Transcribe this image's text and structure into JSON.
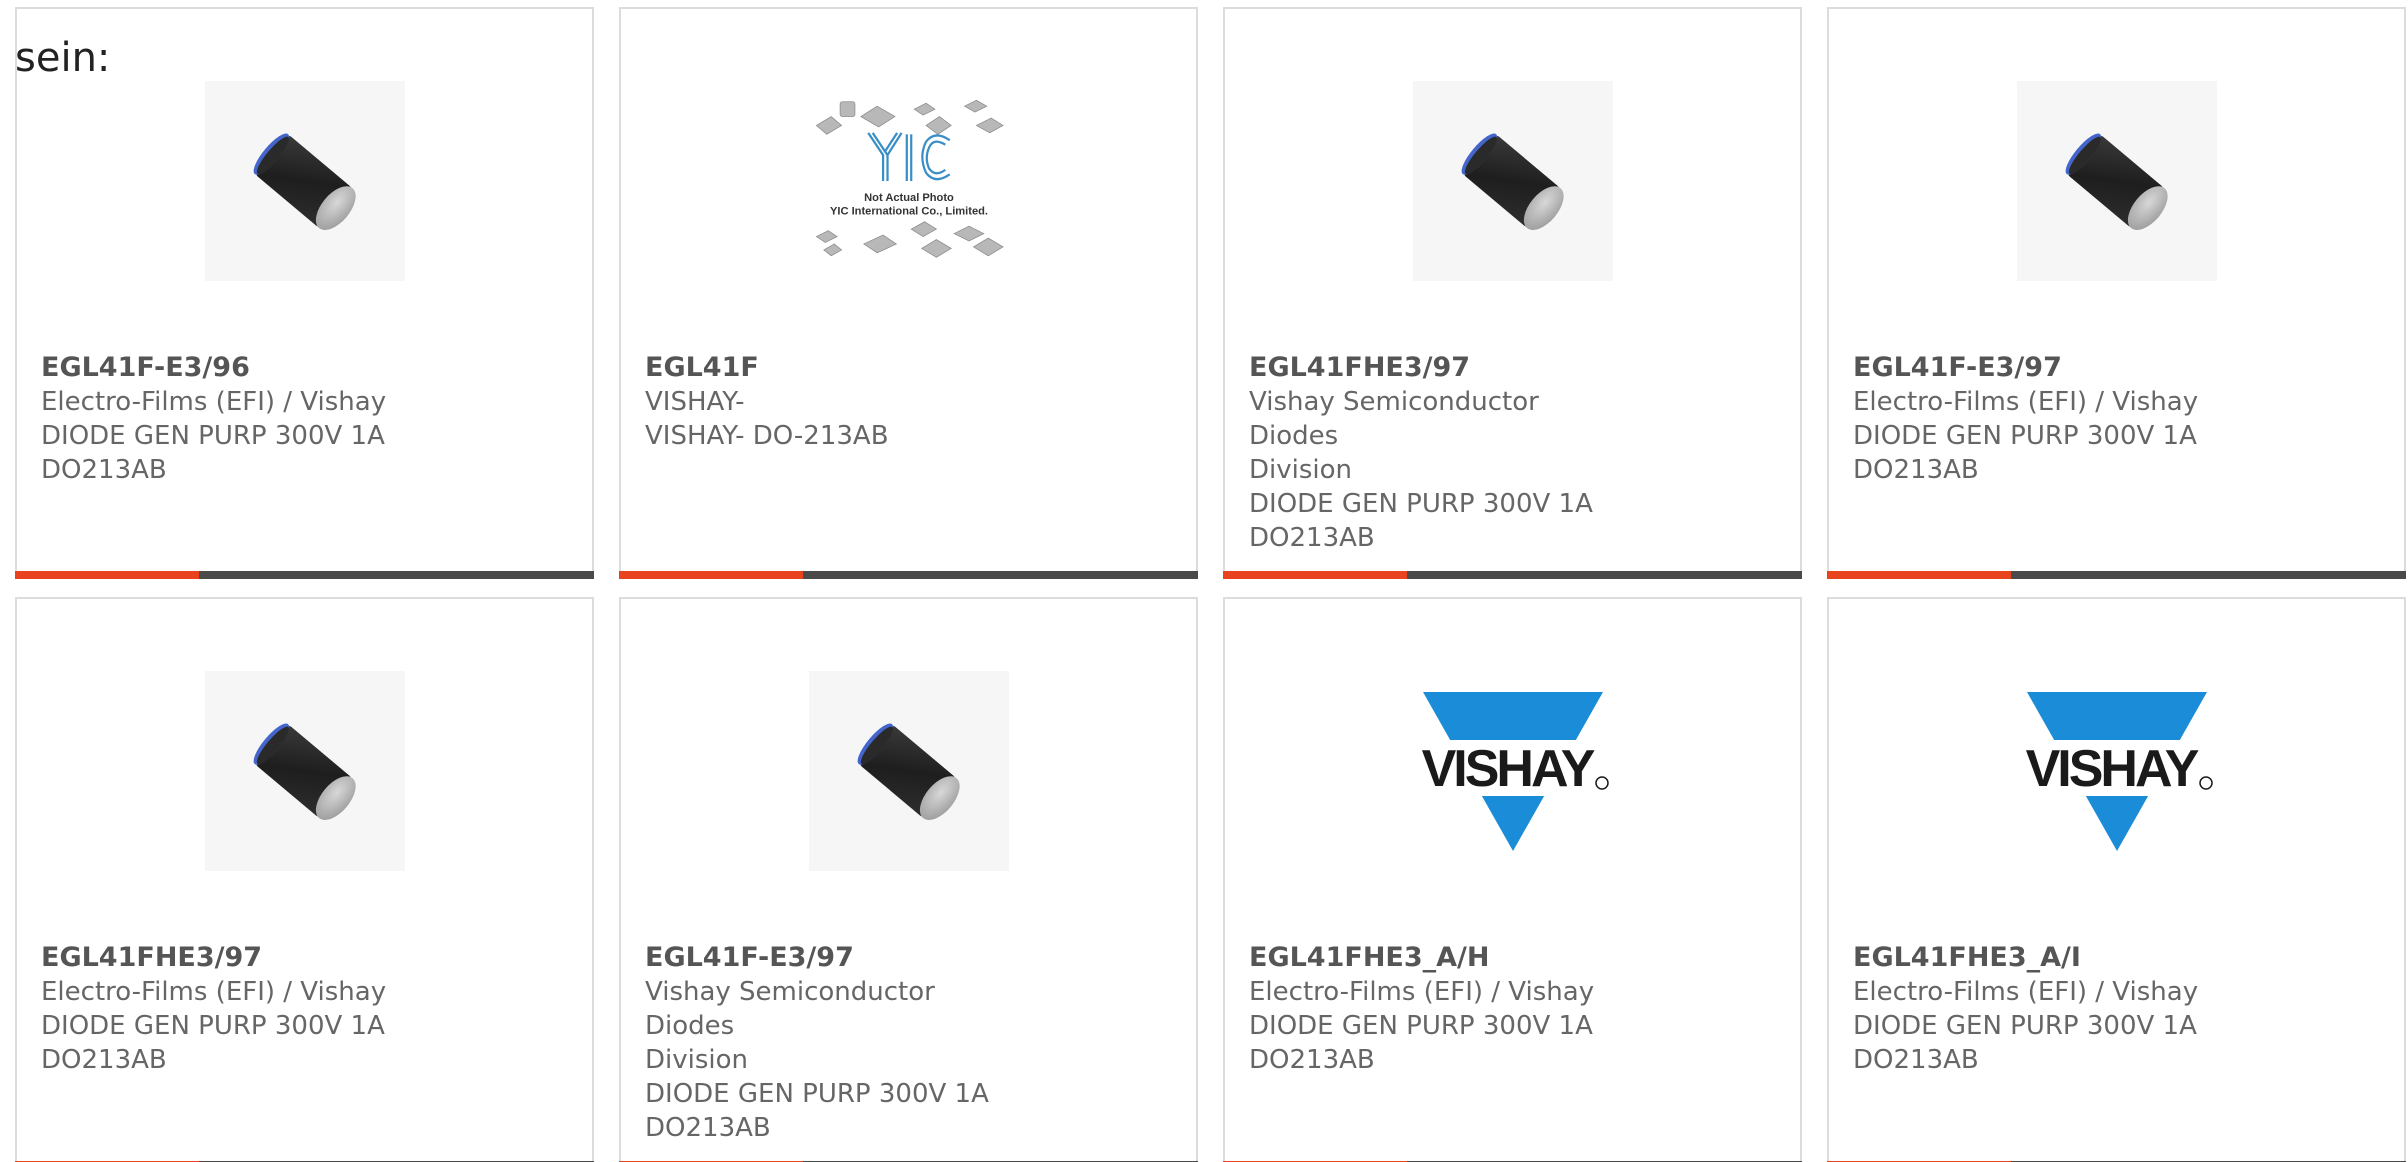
{
  "intro_text": "sein:",
  "colors": {
    "accent": "#e8431e",
    "bar_dark": "#4a4a4a",
    "vishay_blue": "#1a8cd8",
    "yic_blue": "#3a8ec6"
  },
  "yic_image": {
    "line1": "Not Actual Photo",
    "line2": "YIC International Co., Limited.",
    "logo": "YIC"
  },
  "vishay_logo_text": "VISHAY",
  "products": [
    {
      "image": "diode-icon",
      "part": "EGL41F-E3/96",
      "lines": [
        "Electro-Films (EFI) / Vishay",
        "DIODE GEN PURP 300V 1A",
        "DO213AB"
      ]
    },
    {
      "image": "yic-placeholder",
      "part": "EGL41F",
      "lines": [
        "VISHAY-",
        "VISHAY- DO-213AB"
      ]
    },
    {
      "image": "diode-icon",
      "part": "EGL41FHE3/97",
      "lines": [
        "Vishay Semiconductor Diodes",
        "Division",
        "DIODE GEN PURP 300V 1A",
        "DO213AB"
      ]
    },
    {
      "image": "diode-icon",
      "part": "EGL41F-E3/97",
      "lines": [
        "Electro-Films (EFI) / Vishay",
        "DIODE GEN PURP 300V 1A",
        "DO213AB"
      ]
    },
    {
      "image": "diode-icon",
      "part": "EGL41FHE3/97",
      "lines": [
        "Electro-Films (EFI) / Vishay",
        "DIODE GEN PURP 300V 1A",
        "DO213AB"
      ]
    },
    {
      "image": "diode-icon",
      "part": "EGL41F-E3/97",
      "lines": [
        "Vishay Semiconductor Diodes",
        "Division",
        "DIODE GEN PURP 300V 1A",
        "DO213AB"
      ]
    },
    {
      "image": "vishay-logo",
      "part": "EGL41FHE3_A/H",
      "lines": [
        "Electro-Films (EFI) / Vishay",
        "DIODE GEN PURP 300V 1A",
        "DO213AB"
      ]
    },
    {
      "image": "vishay-logo",
      "part": "EGL41FHE3_A/I",
      "lines": [
        "Electro-Films (EFI) / Vishay",
        "DIODE GEN PURP 300V 1A",
        "DO213AB"
      ]
    }
  ]
}
